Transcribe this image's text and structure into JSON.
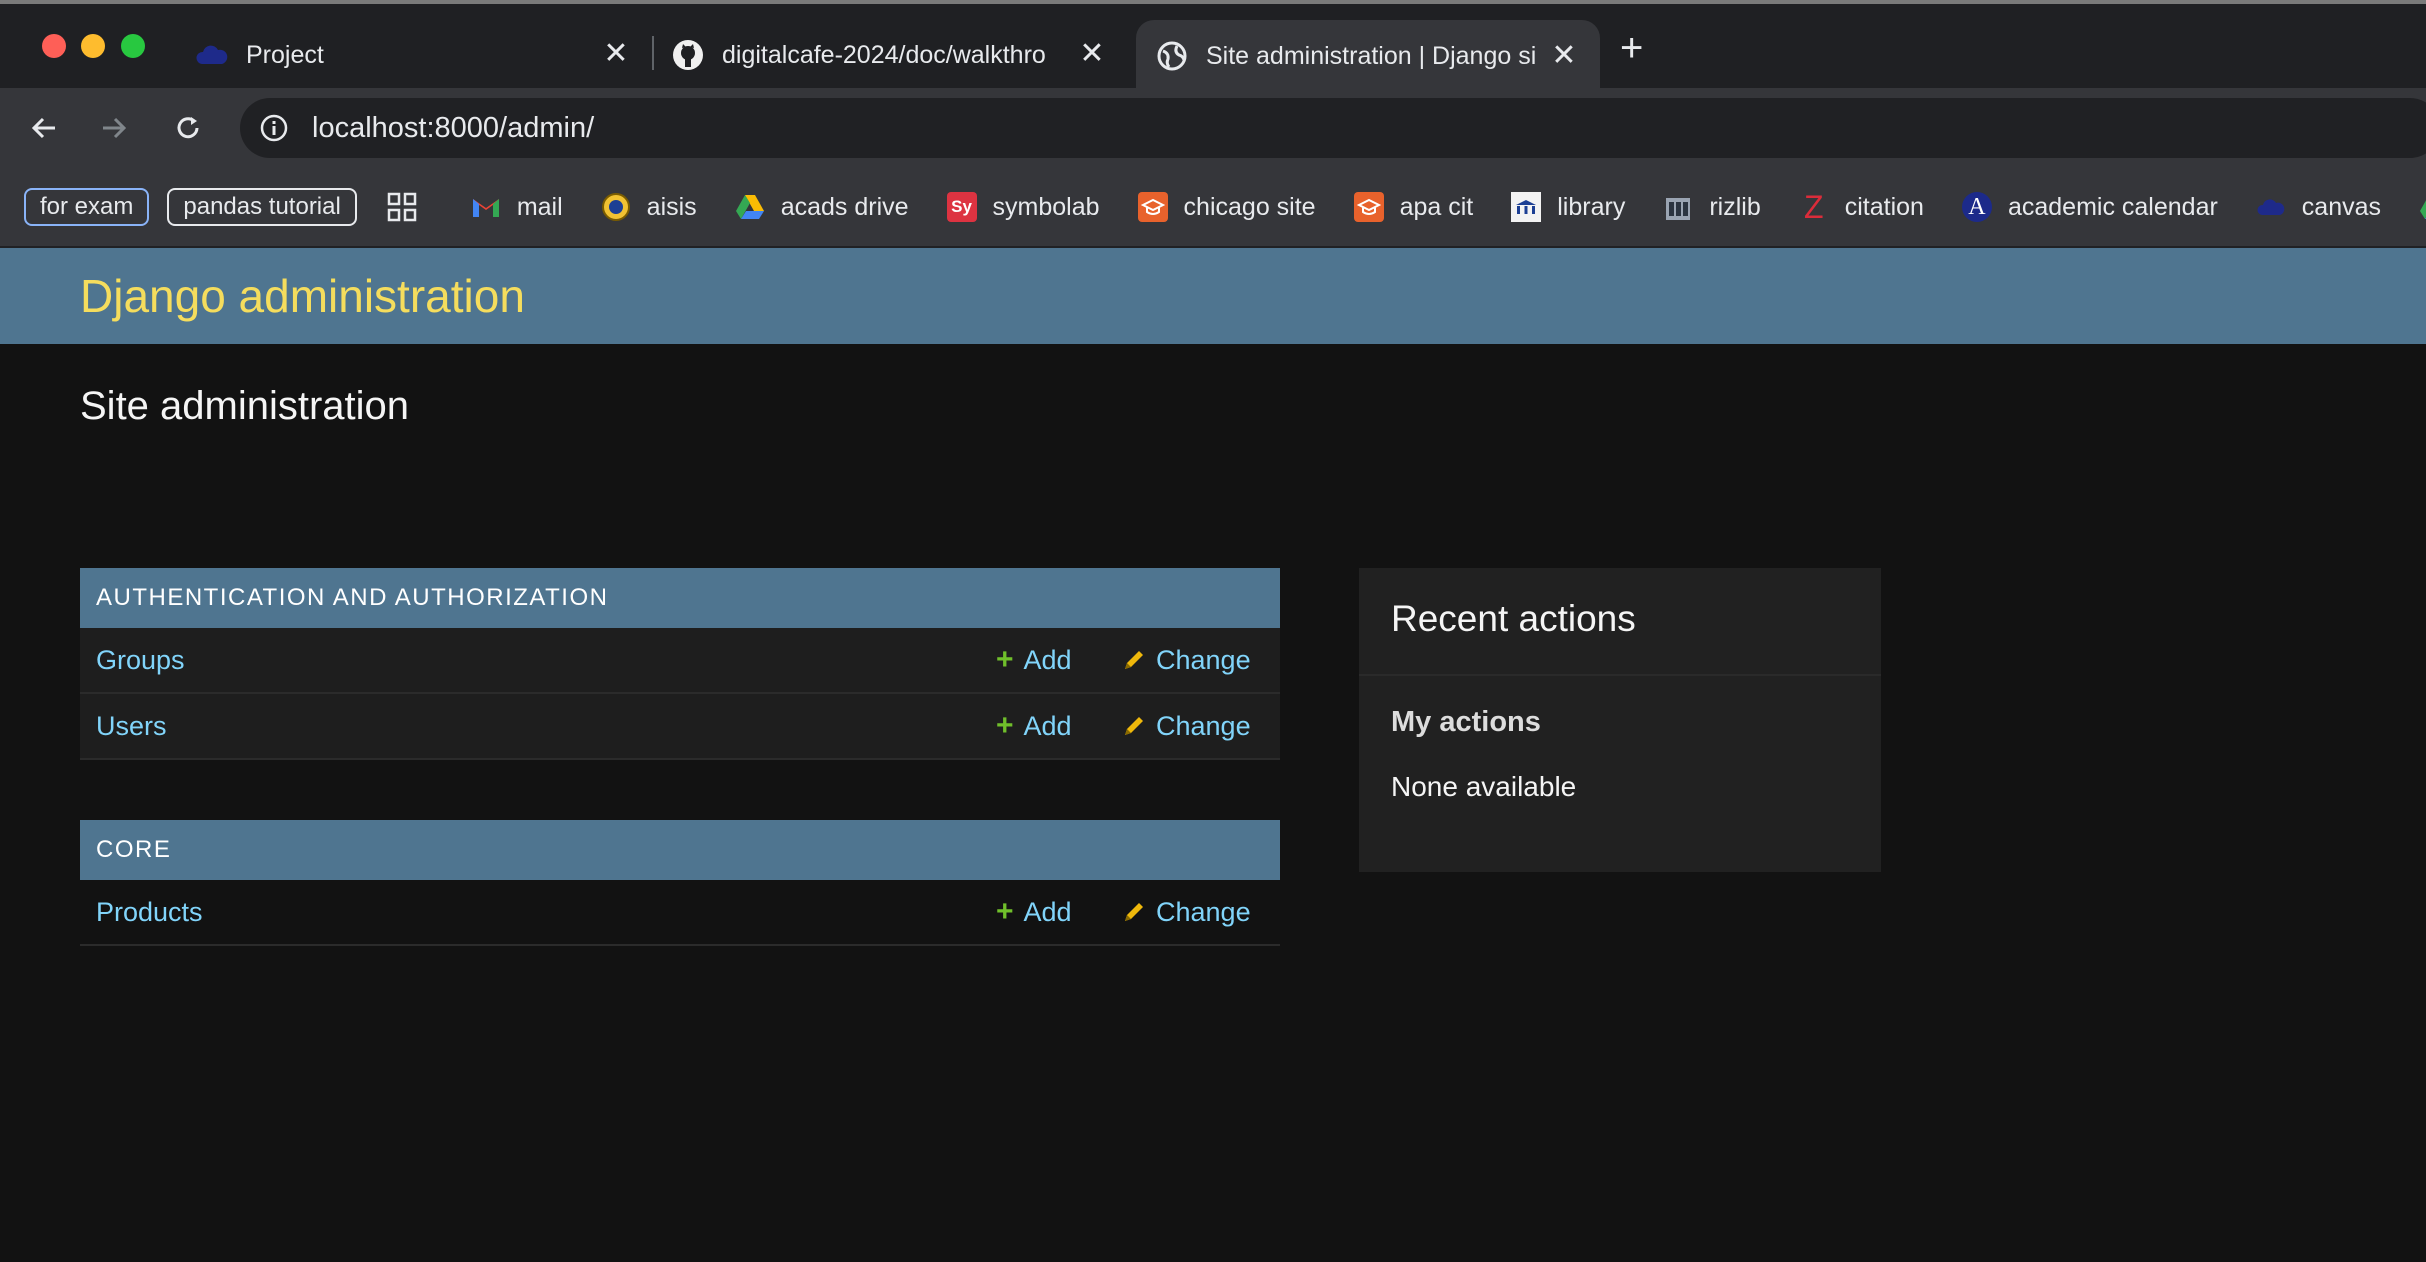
{
  "browser": {
    "tabs": [
      {
        "title": "Project",
        "icon": "cloud-icon",
        "active": false
      },
      {
        "title": "digitalcafe-2024/doc/walkthro",
        "icon": "github-icon",
        "active": false
      },
      {
        "title": "Site administration | Django si",
        "icon": "globe-icon",
        "active": true
      }
    ],
    "new_tab_glyph": "+",
    "close_glyph": "✕",
    "url": "localhost:8000/admin/",
    "bookmarks": {
      "pills": [
        "for exam",
        "pandas tutorial"
      ],
      "items": [
        {
          "label": "mail",
          "icon": "gmail-icon"
        },
        {
          "label": "aisis",
          "icon": "seal-icon"
        },
        {
          "label": "acads drive",
          "icon": "drive-icon"
        },
        {
          "label": "symbolab",
          "icon": "symbolab-icon",
          "icon_text": "Sy"
        },
        {
          "label": "chicago site",
          "icon": "graduation-cap-icon"
        },
        {
          "label": "apa cit",
          "icon": "graduation-cap-icon"
        },
        {
          "label": "library",
          "icon": "library-icon"
        },
        {
          "label": "rizlib",
          "icon": "building-icon"
        },
        {
          "label": "citation",
          "icon": "zotero-icon",
          "icon_text": "Z"
        },
        {
          "label": "academic calendar",
          "icon": "letter-a-icon",
          "icon_text": "A"
        },
        {
          "label": "canvas",
          "icon": "cloud-icon"
        }
      ]
    }
  },
  "django": {
    "branding": "Django administration",
    "page_title": "Site administration",
    "modules": [
      {
        "caption": "AUTHENTICATION AND AUTHORIZATION",
        "models": [
          {
            "name": "Groups",
            "add": "Add",
            "change": "Change"
          },
          {
            "name": "Users",
            "add": "Add",
            "change": "Change"
          }
        ]
      },
      {
        "caption": "CORE",
        "models": [
          {
            "name": "Products",
            "add": "Add",
            "change": "Change"
          }
        ]
      }
    ],
    "recent_actions": {
      "title": "Recent actions",
      "subtitle": "My actions",
      "empty_text": "None available"
    }
  },
  "colors": {
    "header_bg": "#4f7590",
    "branding": "#f5dd5d",
    "link": "#81d4fa",
    "add_plus": "#70bf2b",
    "change_pencil": "#efb80b"
  }
}
